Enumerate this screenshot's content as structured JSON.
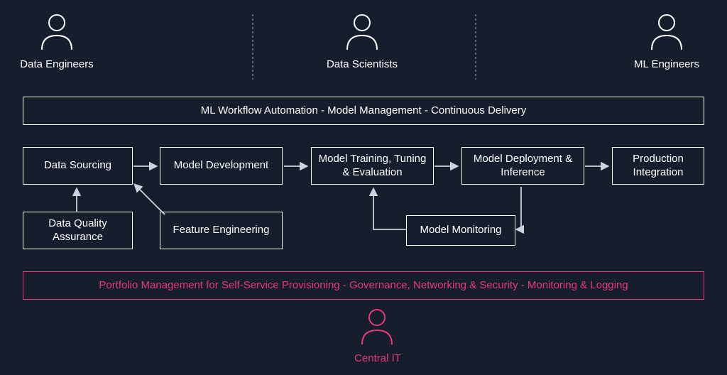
{
  "roles": {
    "data_engineers": "Data Engineers",
    "data_scientists": "Data Scientists",
    "ml_engineers": "ML Engineers",
    "central_it": "Central IT"
  },
  "bars": {
    "top": "ML Workflow Automation - Model Management - Continuous Delivery",
    "bottom": "Portfolio Management for Self-Service Provisioning - Governance, Networking & Security - Monitoring & Logging"
  },
  "nodes": {
    "data_sourcing": "Data Sourcing",
    "data_quality": "Data Quality Assurance",
    "model_dev": "Model Development",
    "feature_eng": "Feature Engineering",
    "model_train": "Model Training, Tuning & Evaluation",
    "model_monitor": "Model Monitoring",
    "model_deploy": "Model Deployment & Inference",
    "prod_integration": "Production Integration"
  }
}
